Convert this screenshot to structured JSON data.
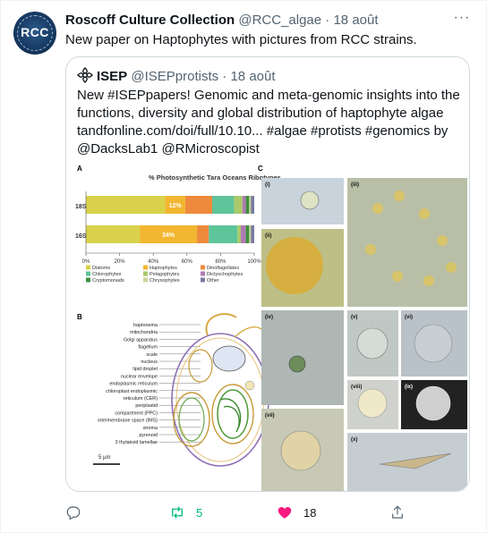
{
  "author": {
    "name": "Roscoff Culture Collection",
    "handle": "@RCC_algae",
    "time": "18 août",
    "avatar_text": "RCC"
  },
  "tweet_text": "New paper on Haptophytes with pictures from RCC strains.",
  "quoted": {
    "name": "ISEP",
    "handle": "@ISEPprotists",
    "time": "18 août",
    "text_lines": [
      "New #ISEPpapers! Genomic and meta-genomic insights into the",
      "functions, diversity and global distribution of haptophyte algae",
      "tandfonline.com/doi/full/10.10... #algae #protists #genomics by",
      "@DacksLab1 @RMicroscopist"
    ]
  },
  "figure": {
    "panel_a": "A",
    "panel_b": "B",
    "panel_c": "C",
    "chart_title": "% Photosynthetic Tara Oceans Ribotypes",
    "rows": [
      {
        "label": "18S",
        "value_label": "12%"
      },
      {
        "label": "16S",
        "value_label": "34%"
      }
    ],
    "ticks": [
      "0%",
      "20%",
      "40%",
      "60%",
      "80%",
      "100%"
    ],
    "legend": [
      "Diatoms",
      "Haptophytes",
      "Dinoflagellates",
      "Chlorophytes",
      "Pelagophytes",
      "Dictyochophytes",
      "Cryptomonads",
      "Chrysophytes",
      "Other"
    ],
    "cell_labels": [
      "haptonema",
      "mitochondria",
      "Golgi apparatus",
      "flagellum",
      "scale",
      "nucleus",
      "lipid droplet",
      "nuclear envelope",
      "endoplasmic reticulum",
      "chloroplast endoplasmic",
      "reticulum (CER)",
      "periplastid",
      "compartment (PPC)",
      "intermembrane space (IMS)",
      "stroma",
      "pyrenoid",
      "3 thylakoid lamellae"
    ],
    "scale_label": "5 µm",
    "micro_labels": [
      "(i)",
      "(ii)",
      "(iii)",
      "(iv)",
      "(v)",
      "(vi)",
      "(vii)",
      "(viii)",
      "(ix)",
      "(x)"
    ]
  },
  "chart_data": {
    "type": "bar",
    "title": "% Photosynthetic Tara Oceans Ribotypes",
    "categories": [
      "18S",
      "16S"
    ],
    "xlim": [
      0,
      100
    ],
    "series": [
      {
        "name": "Diatoms",
        "values": [
          47,
          32
        ]
      },
      {
        "name": "Haptophytes",
        "values": [
          12,
          34
        ]
      },
      {
        "name": "Dinoflagellates",
        "values": [
          16,
          7
        ]
      },
      {
        "name": "Chlorophytes",
        "values": [
          13,
          17
        ]
      },
      {
        "name": "Pelagophytes",
        "values": [
          5,
          2
        ]
      },
      {
        "name": "Dictyochophytes",
        "values": [
          2,
          3
        ]
      },
      {
        "name": "Cryptomonads",
        "values": [
          2,
          2
        ]
      },
      {
        "name": "Chrysophytes",
        "values": [
          1,
          1
        ]
      },
      {
        "name": "Other",
        "values": [
          2,
          2
        ]
      }
    ],
    "colors": [
      "#d9d24a",
      "#f2b630",
      "#ee8a3c",
      "#5ec49a",
      "#a9c96a",
      "#b07ab2",
      "#3f8e3f",
      "#c8d79a",
      "#7b7b9e"
    ]
  },
  "actions": {
    "reply_count": "",
    "retweet_count": "5",
    "like_count": "18"
  },
  "colors": {
    "retweet": "#00ba7c",
    "like": "#f91880",
    "muted": "#536471"
  }
}
